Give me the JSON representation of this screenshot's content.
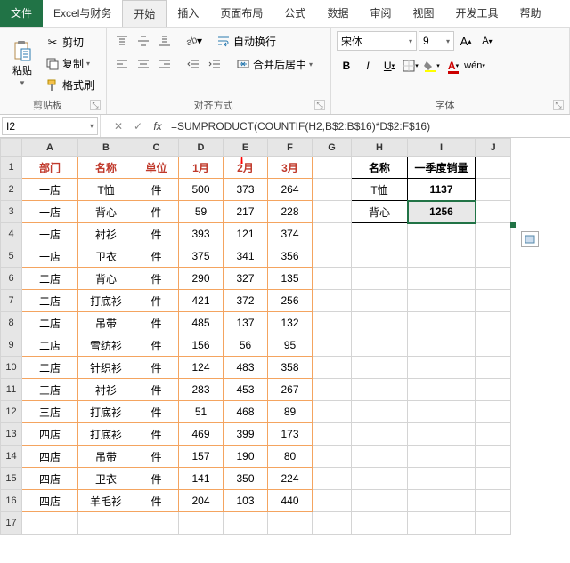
{
  "menu": {
    "items": [
      "文件",
      "Excel与财务",
      "开始",
      "插入",
      "页面布局",
      "公式",
      "数据",
      "审阅",
      "视图",
      "开发工具",
      "帮助"
    ],
    "active": 2
  },
  "ribbon": {
    "clipboard": {
      "paste": "粘贴",
      "cut": "剪切",
      "copy": "复制",
      "format_painter": "格式刷",
      "label": "剪贴板"
    },
    "alignment": {
      "wrap": "自动换行",
      "merge": "合并后居中",
      "label": "对齐方式"
    },
    "font": {
      "name": "宋体",
      "size": "9",
      "label": "字体"
    }
  },
  "formula_bar": {
    "cell": "I2",
    "formula": "=SUMPRODUCT(COUNTIF(H2,B$2:B$16)*D$2:F$16)"
  },
  "columns": [
    "A",
    "B",
    "C",
    "D",
    "E",
    "F",
    "G",
    "H",
    "I",
    "J"
  ],
  "rows_count": 17,
  "table_main": {
    "headers": [
      "部门",
      "名称",
      "单位",
      "1月",
      "2月",
      "3月"
    ],
    "rows": [
      [
        "一店",
        "T恤",
        "件",
        "500",
        "373",
        "264"
      ],
      [
        "一店",
        "背心",
        "件",
        "59",
        "217",
        "228"
      ],
      [
        "一店",
        "衬衫",
        "件",
        "393",
        "121",
        "374"
      ],
      [
        "一店",
        "卫衣",
        "件",
        "375",
        "341",
        "356"
      ],
      [
        "二店",
        "背心",
        "件",
        "290",
        "327",
        "135"
      ],
      [
        "二店",
        "打底衫",
        "件",
        "421",
        "372",
        "256"
      ],
      [
        "二店",
        "吊带",
        "件",
        "485",
        "137",
        "132"
      ],
      [
        "二店",
        "雪纺衫",
        "件",
        "156",
        "56",
        "95"
      ],
      [
        "二店",
        "针织衫",
        "件",
        "124",
        "483",
        "358"
      ],
      [
        "三店",
        "衬衫",
        "件",
        "283",
        "453",
        "267"
      ],
      [
        "三店",
        "打底衫",
        "件",
        "51",
        "468",
        "89"
      ],
      [
        "四店",
        "打底衫",
        "件",
        "469",
        "399",
        "173"
      ],
      [
        "四店",
        "吊带",
        "件",
        "157",
        "190",
        "80"
      ],
      [
        "四店",
        "卫衣",
        "件",
        "141",
        "350",
        "224"
      ],
      [
        "四店",
        "羊毛衫",
        "件",
        "204",
        "103",
        "440"
      ]
    ]
  },
  "table_side": {
    "headers": [
      "名称",
      "一季度销量"
    ],
    "rows": [
      [
        "T恤",
        "1137"
      ],
      [
        "背心",
        "1256"
      ]
    ]
  },
  "selected_cell": "I3"
}
